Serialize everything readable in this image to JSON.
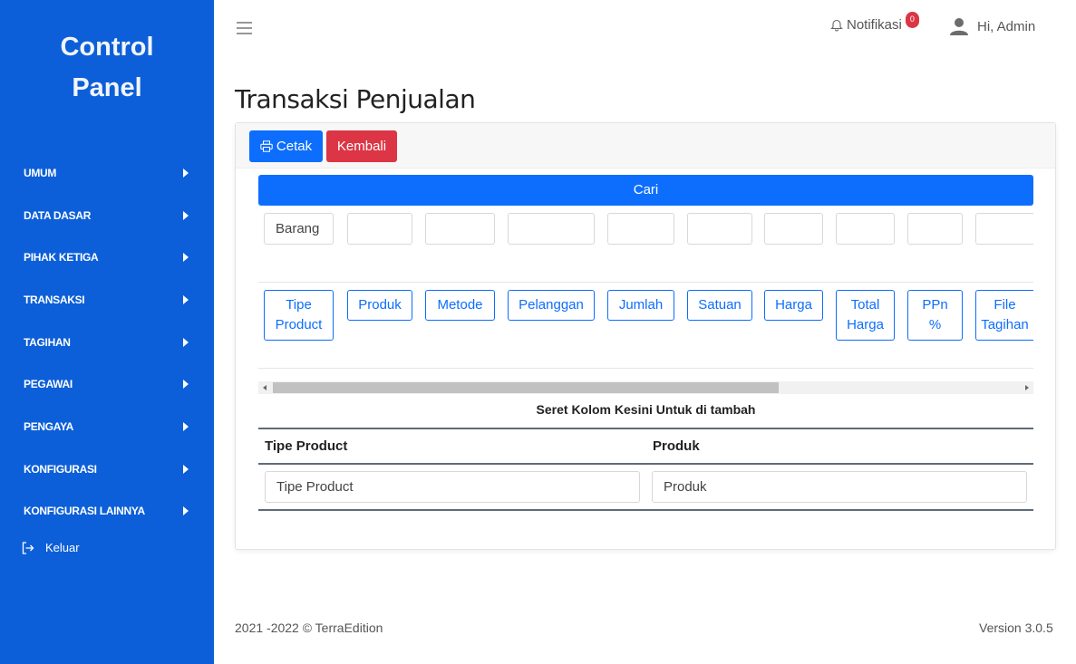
{
  "sidebar": {
    "brand_line1": "Control",
    "brand_line2": "Panel",
    "items": [
      {
        "label": "UMUM"
      },
      {
        "label": "DATA DASAR"
      },
      {
        "label": "PIHAK KETIGA"
      },
      {
        "label": "TRANSAKSI"
      },
      {
        "label": "TAGIHAN"
      },
      {
        "label": "PEGAWAI"
      },
      {
        "label": "PENGAYA"
      },
      {
        "label": "KONFIGURASI"
      },
      {
        "label": "KONFIGURASI LAINNYA"
      }
    ],
    "logout_label": "Keluar",
    "background_color": "#0c5fd8"
  },
  "topbar": {
    "notif_label": "Notifikasi",
    "notif_count": "0",
    "user_label": "Hi, Admin"
  },
  "page": {
    "title": "Transaksi Penjualan"
  },
  "toolbar": {
    "print_label": "Cetak",
    "back_label": "Kembali"
  },
  "search": {
    "label": "Cari"
  },
  "filters": {
    "first_value": "Barang"
  },
  "columns": [
    {
      "line1": "Tipe",
      "line2": "Product"
    },
    {
      "line1": "Produk",
      "line2": ""
    },
    {
      "line1": "Metode",
      "line2": ""
    },
    {
      "line1": "Pelanggan",
      "line2": ""
    },
    {
      "line1": "Jumlah",
      "line2": ""
    },
    {
      "line1": "Satuan",
      "line2": ""
    },
    {
      "line1": "Harga",
      "line2": ""
    },
    {
      "line1": "Total",
      "line2": "Harga"
    },
    {
      "line1": "PPn",
      "line2": "%"
    },
    {
      "line1": "File",
      "line2": "Tagihan"
    }
  ],
  "grid": {
    "drop_hint": "Seret Kolom Kesini Untuk di tambah",
    "headers": [
      "Tipe Product",
      "Produk"
    ],
    "inputs": [
      "Tipe Product",
      "Produk"
    ]
  },
  "footer": {
    "copyright": "2021 -2022 © TerraEdition",
    "version": "Version 3.0.5"
  },
  "colors": {
    "primary": "#0d6efd",
    "danger": "#dc3545"
  }
}
